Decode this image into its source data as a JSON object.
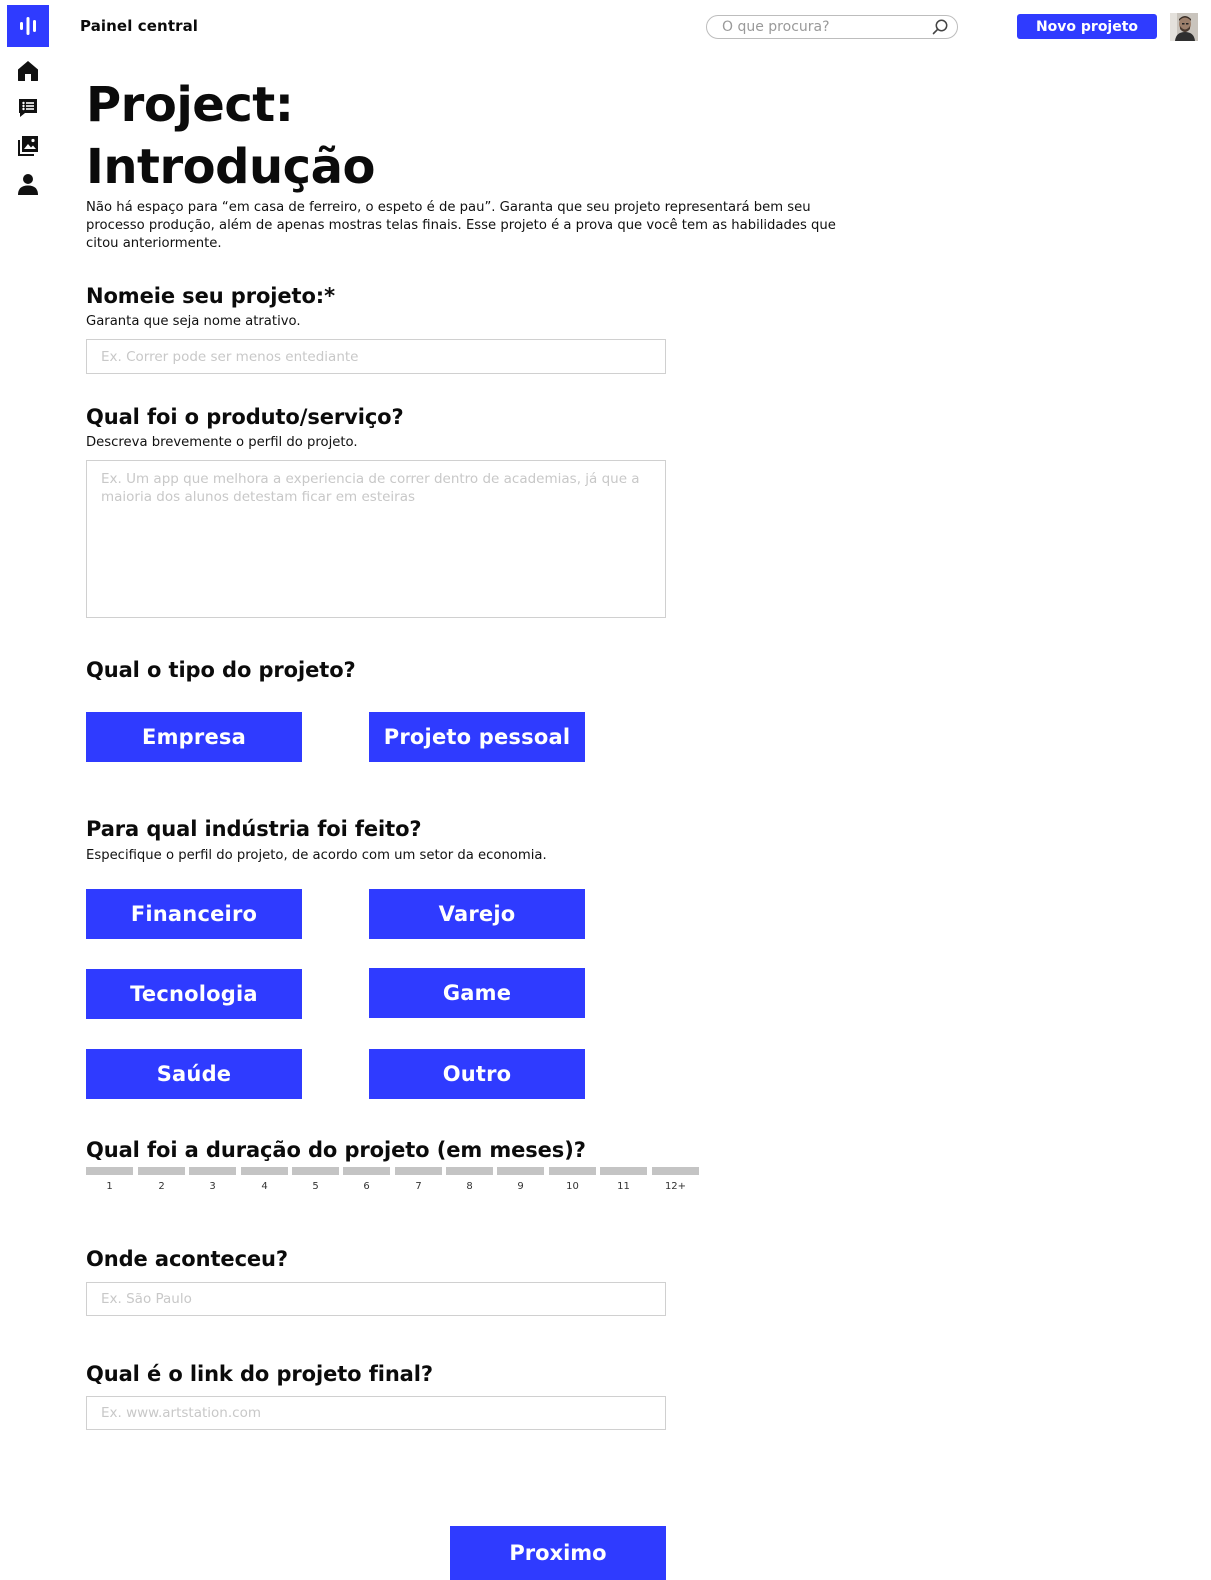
{
  "header": {
    "app_title": "Painel central",
    "search_placeholder": "O que procura?",
    "new_project_label": "Novo projeto"
  },
  "sidebar": {
    "items": [
      {
        "icon": "home-icon"
      },
      {
        "icon": "feed-icon"
      },
      {
        "icon": "gallery-icon"
      },
      {
        "icon": "profile-icon"
      }
    ]
  },
  "page": {
    "title_line1": "Project:",
    "title_line2": "Introdução",
    "intro": "Não há espaço para “em casa de ferreiro, o espeto é de pau”. Garanta que seu projeto representará bem seu processo produção, além de apenas mostras telas finais. Esse projeto é a prova que você tem as habilidades que citou anteriormente."
  },
  "name_section": {
    "title": "Nomeie seu projeto:*",
    "subtitle": "Garanta que seja nome atrativo.",
    "placeholder": "Ex. Correr pode ser menos entediante"
  },
  "product_section": {
    "title": "Qual foi o produto/serviço?",
    "subtitle": "Descreva brevemente o perfil do projeto.",
    "placeholder": "Ex. Um app que melhora a experiencia de correr dentro de academias, já que a maioria dos alunos detestam ficar em esteiras"
  },
  "type_section": {
    "title": "Qual o tipo do projeto?",
    "options": [
      "Empresa",
      "Projeto pessoal"
    ]
  },
  "industry_section": {
    "title": "Para qual indústria foi feito?",
    "subtitle": "Especifique o perfil do projeto, de acordo com um setor da economia.",
    "options": [
      "Financeiro",
      "Varejo",
      "Tecnologia",
      "Game",
      "Saúde",
      "Outro"
    ]
  },
  "duration_section": {
    "title": "Qual foi a duração do projeto (em meses)?",
    "labels": [
      "1",
      "2",
      "3",
      "4",
      "5",
      "6",
      "7",
      "8",
      "9",
      "10",
      "11",
      "12+"
    ]
  },
  "location_section": {
    "title": "Onde aconteceu?",
    "placeholder": "Ex. São Paulo"
  },
  "link_section": {
    "title": "Qual é o link do projeto final?",
    "placeholder": "Ex. www.artstation.com"
  },
  "footer": {
    "next_label": "Proximo"
  },
  "colors": {
    "accent": "#2f3bff",
    "segment": "#c4c4c4"
  }
}
